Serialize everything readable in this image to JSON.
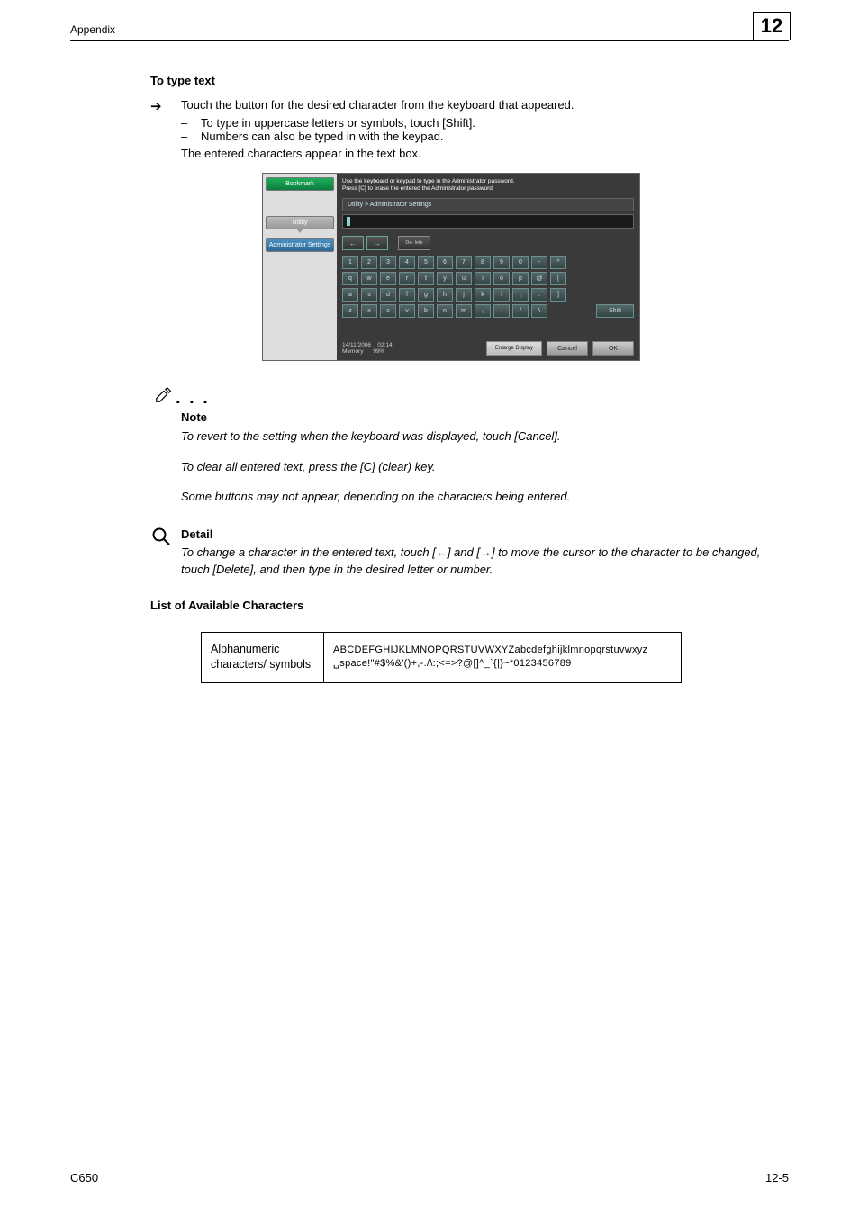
{
  "header": {
    "appendix": "Appendix",
    "chapter": "12"
  },
  "section": {
    "title": "To type text",
    "arrow_text": "Touch the button for the desired character from the keyboard that appeared.",
    "dash1": "To type in uppercase letters or symbols, touch [Shift].",
    "dash2": "Numbers can also be typed in with the keypad.",
    "after": "The entered characters appear in the text box."
  },
  "keyboard": {
    "msg1": "Use the keyboard or keypad to type in the Administrator password.",
    "msg2": "Press [C] to erase the entered the Administrator password.",
    "breadcrumb": "Utility > Administrator Settings",
    "left": {
      "bookmark": "Bookmark",
      "utility": "Utility",
      "admin": "Administrator Settings"
    },
    "delete": "De-\nlete",
    "shift": "Shift",
    "rows": {
      "r1": [
        "1",
        "2",
        "3",
        "4",
        "5",
        "6",
        "7",
        "8",
        "9",
        "0",
        "-",
        "^"
      ],
      "r2": [
        "q",
        "w",
        "e",
        "r",
        "t",
        "y",
        "u",
        "i",
        "o",
        "p",
        "@",
        "["
      ],
      "r3": [
        "a",
        "s",
        "d",
        "f",
        "g",
        "h",
        "j",
        "k",
        "l",
        ";",
        ":",
        "]"
      ],
      "r4": [
        "z",
        "x",
        "c",
        "v",
        "b",
        "n",
        "m",
        ",",
        ".",
        "/",
        "\\"
      ]
    },
    "footer": {
      "date": "14/11/2006",
      "time": "02:14",
      "memory_label": "Memory",
      "memory_val": "99%",
      "enlarge": "Enlarge Display",
      "cancel": "Cancel",
      "ok": "OK"
    }
  },
  "note": {
    "dots": ". . .",
    "label": "Note",
    "p1": "To revert to the setting when the keyboard was displayed, touch [Cancel].",
    "p2": "To clear all entered text, press the [C] (clear) key.",
    "p3": "Some buttons may not appear, depending on the characters being entered."
  },
  "detail": {
    "label": "Detail",
    "body": "To change a character in the entered text, touch [←] and [→] to move the cursor to the character to be changed, touch [Delete], and then type in the desired letter or number."
  },
  "list_heading": "List of Available Characters",
  "table": {
    "left": "Alphanumeric characters/ symbols",
    "right_line1": "ABCDEFGHIJKLMNOPQRSTUVWXYZabcdefghijklmnopqrstuvwxyz",
    "right_line2": "␣space!\"#$%&'()+,-./\\:;<=>?@[]^_`{|}~*0123456789"
  },
  "footer": {
    "left": "C650",
    "right": "12-5"
  }
}
